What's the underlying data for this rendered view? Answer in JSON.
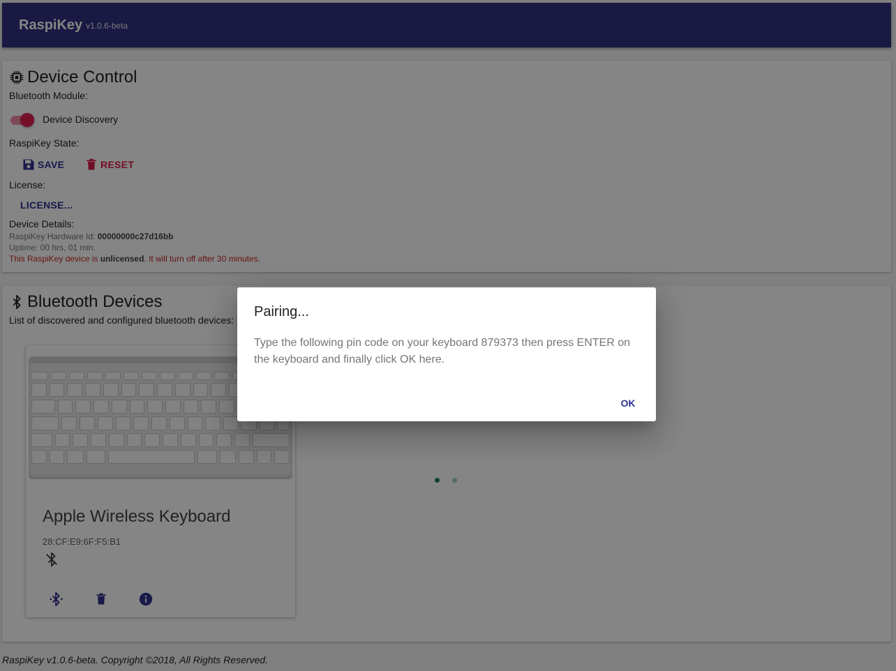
{
  "app": {
    "name": "RaspiKey",
    "version": "v1.0.6-beta"
  },
  "device_control": {
    "title": "Device Control",
    "bluetooth_module_label": "Bluetooth Module:",
    "device_discovery_label": "Device Discovery",
    "device_discovery_on": true,
    "state_label": "RaspiKey State:",
    "save_label": "SAVE",
    "reset_label": "RESET",
    "license_label": "License:",
    "license_button": "LICENSE...",
    "details_label": "Device Details:",
    "hardware_id_label": "RaspiKey Hardware Id:",
    "hardware_id": "00000000c27d16bb",
    "uptime": "Uptime: 00 hrs, 01 min.",
    "license_warning_pre": "This RaspiKey device is",
    "license_warning_bold": "unlicensed",
    "license_warning_post": ". It will turn off after 30 minutes."
  },
  "bluetooth_devices": {
    "title": "Bluetooth Devices",
    "subtitle": "List of discovered and configured bluetooth devices:",
    "devices": [
      {
        "name": "Apple Wireless Keyboard",
        "mac": "28:CF:E9:6F:F5:B1",
        "status_icon": "bluetooth-disabled-icon"
      }
    ],
    "carousel": {
      "pages": 2,
      "active": 1
    }
  },
  "footer": "RaspiKey v1.0.6-beta. Copyright ©2018, All Rights Reserved.",
  "dialog": {
    "title": "Pairing...",
    "text": "Type the following pin code on your keyboard 879373 then press ENTER on the keyboard and finally click OK here.",
    "ok_label": "OK"
  },
  "colors": {
    "appbar": "#303080",
    "primary": "#303090",
    "accent": "#d81b4a",
    "carousel_dot": "#1e7a5a"
  }
}
